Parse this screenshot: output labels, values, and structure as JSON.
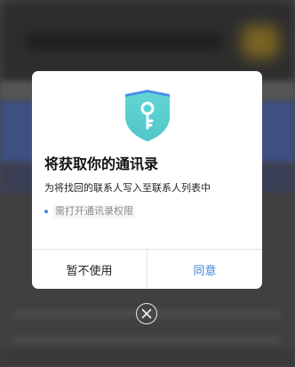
{
  "dialog": {
    "icon": "shield-key-icon",
    "title": "将获取你的通讯录",
    "description": "为将找回的联系人写入至联系人列表中",
    "permissions": [
      {
        "label": "需打开通讯录权限"
      }
    ],
    "buttons": {
      "deny_label": "暂不使用",
      "allow_label": "同意"
    }
  },
  "close": {
    "icon": "close-icon"
  },
  "colors": {
    "accent": "#3b82d6",
    "shield_top": "#4a8fe8",
    "shield_body": "#5ed3d0",
    "overlay": "#474747"
  }
}
